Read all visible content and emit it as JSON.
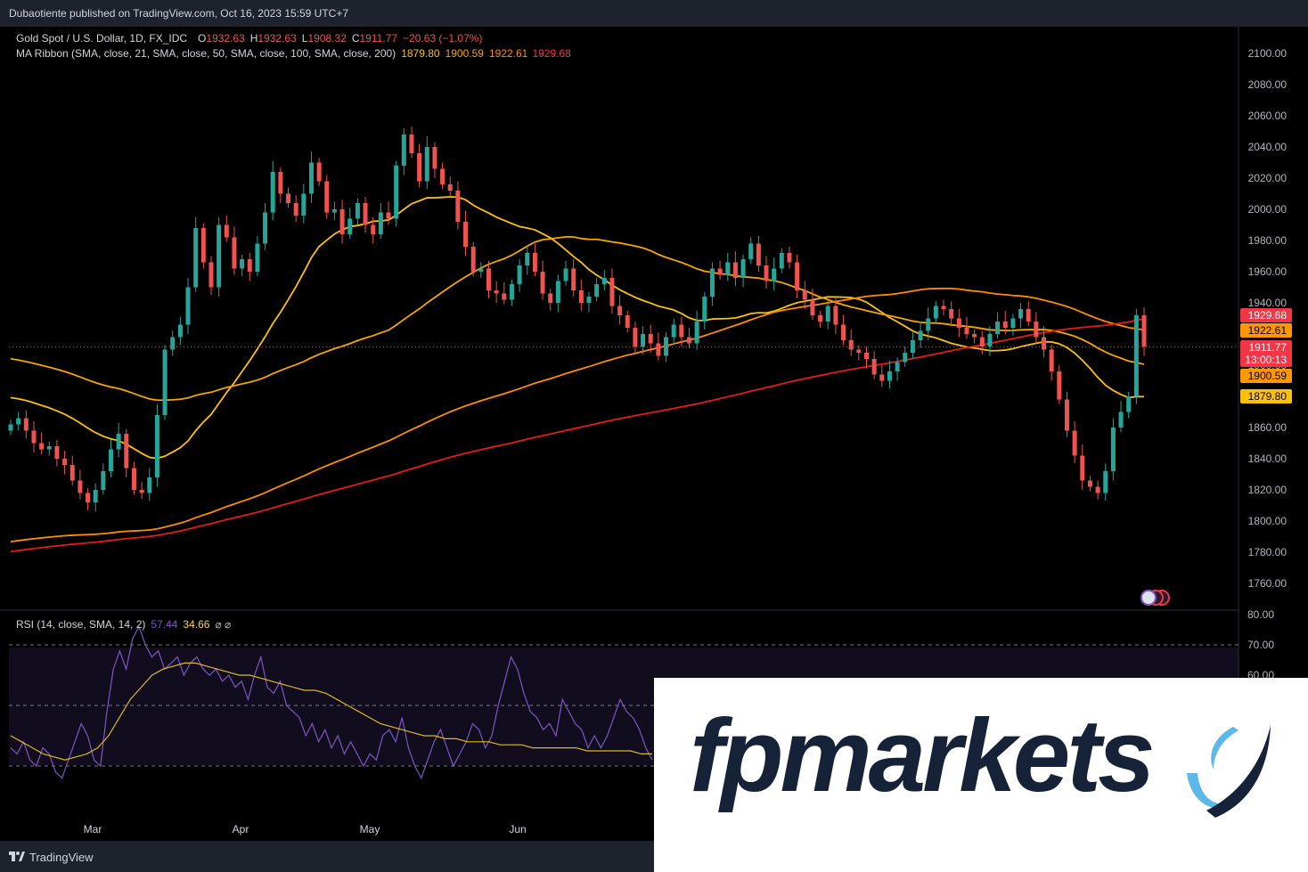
{
  "header": {
    "published": "Dubaotiente published on TradingView.com, Oct 16, 2023 15:59 UTC+7"
  },
  "legend": {
    "symbol": "Gold Spot / U.S. Dollar, 1D, FX_IDC",
    "o_label": "O",
    "o_value": "1932.63",
    "h_label": "H",
    "h_value": "1932.63",
    "l_label": "L",
    "l_value": "1908.32",
    "c_label": "C",
    "c_value": "1911.77",
    "change": "−20.63 (−1.07%)",
    "ma_label": "MA Ribbon (SMA, close, 21, SMA, close, 50, SMA, close, 100, SMA, close, 200)",
    "ma_values": [
      "1879.80",
      "1900.59",
      "1922.61",
      "1929.68"
    ],
    "rsi_label": "RSI (14, close, SMA, 14, 2)",
    "rsi_value": "57.44",
    "rsi_ma_value": "34.66",
    "rsi_extra": "⌀  ⌀"
  },
  "price_tags": [
    {
      "text": "1929.68",
      "value": 1929.68,
      "color": "#f23645"
    },
    {
      "text": "1922.61",
      "value": 1922.61,
      "color": "#ff9800"
    },
    {
      "text": "1911.77",
      "sub": "13:00:13",
      "value": 1911.77,
      "color": "#f23645"
    },
    {
      "text": "1900.59",
      "value": 1900.59,
      "color": "#ff9800"
    },
    {
      "text": "1879.80",
      "value": 1879.8,
      "color": "#ffc107"
    }
  ],
  "colors": {
    "up": "#26a69a",
    "down": "#ef5350",
    "ma21": "#ffc107",
    "ma50": "#f7a600",
    "ma100": "#ff8c00",
    "ma200": "#e31b1b",
    "rsi": "#7e57c2",
    "rsi_ma": "#ddb825"
  },
  "chart_data": [
    {
      "type": "candlestick",
      "title": "Gold Spot / U.S. Dollar, 1D, FX_IDC",
      "ylim": [
        1750,
        2110
      ],
      "y_ticks": [
        1760,
        1780,
        1800,
        1820,
        1840,
        1860,
        1880,
        1900,
        1920,
        1940,
        1960,
        1980,
        2000,
        2020,
        2040,
        2060,
        2080,
        2100
      ],
      "x_tick_labels": [
        "Mar",
        "Apr",
        "May",
        "Jun"
      ],
      "last_price": 1911.77,
      "close_series": [
        1862,
        1866,
        1858,
        1850,
        1846,
        1848,
        1840,
        1836,
        1826,
        1818,
        1812,
        1820,
        1832,
        1846,
        1856,
        1834,
        1820,
        1818,
        1828,
        1868,
        1910,
        1918,
        1926,
        1950,
        1988,
        1966,
        1950,
        1990,
        1982,
        1962,
        1968,
        1960,
        1978,
        1998,
        2024,
        2010,
        2004,
        1996,
        2010,
        2030,
        2018,
        1998,
        2000,
        1984,
        1994,
        2004,
        1990,
        1984,
        1998,
        1994,
        2028,
        2048,
        2036,
        2018,
        2040,
        2026,
        2016,
        2012,
        1992,
        1976,
        1960,
        1962,
        1948,
        1946,
        1942,
        1952,
        1964,
        1972,
        1960,
        1946,
        1940,
        1954,
        1962,
        1948,
        1940,
        1944,
        1952,
        1956,
        1938,
        1932,
        1924,
        1912,
        1920,
        1914,
        1906,
        1918,
        1926,
        1918,
        1914,
        1928,
        1944,
        1962,
        1958,
        1966,
        1956,
        1968,
        1978,
        1964,
        1954,
        1962,
        1972,
        1966,
        1948,
        1942,
        1932,
        1928,
        1938,
        1926,
        1916,
        1910,
        1908,
        1904,
        1894,
        1890,
        1896,
        1902,
        1908,
        1916,
        1922,
        1930,
        1938,
        1936,
        1930,
        1924,
        1920,
        1918,
        1912,
        1920,
        1928,
        1924,
        1930,
        1936,
        1928,
        1918,
        1910,
        1896,
        1878,
        1858,
        1842,
        1826,
        1822,
        1818,
        1832,
        1860,
        1870,
        1880,
        1932,
        1912
      ],
      "series": [
        {
          "name": "MA 21",
          "start": 1880,
          "end": 1879.8
        },
        {
          "name": "MA 50",
          "start": 1905,
          "end": 1900.59
        },
        {
          "name": "MA 100",
          "start": 1786,
          "end": 1922.61
        },
        {
          "name": "MA 200",
          "start": 1780,
          "end": 1929.68
        }
      ]
    },
    {
      "type": "line",
      "title": "RSI (14, close, SMA, 14, 2)",
      "ylim": [
        50,
        80
      ],
      "y_ticks": [
        60,
        70,
        80
      ],
      "levels": [
        70,
        50,
        30
      ],
      "series": [
        {
          "name": "RSI",
          "values": [
            36,
            34,
            38,
            32,
            30,
            36,
            34,
            28,
            26,
            32,
            38,
            44,
            40,
            32,
            30,
            48,
            62,
            68,
            62,
            72,
            76,
            70,
            66,
            68,
            62,
            64,
            66,
            60,
            64,
            66,
            62,
            60,
            62,
            58,
            60,
            56,
            58,
            52,
            60,
            66,
            56,
            54,
            58,
            50,
            48,
            46,
            40,
            44,
            38,
            42,
            36,
            40,
            34,
            38,
            34,
            30,
            34,
            32,
            40,
            42,
            38,
            46,
            36,
            30,
            26,
            32,
            38,
            42,
            36,
            30,
            34,
            38,
            44,
            42,
            36,
            40,
            50,
            58,
            66,
            62,
            54,
            48,
            46,
            42,
            44,
            40,
            52,
            48,
            44,
            42,
            36,
            40,
            36,
            40,
            46,
            52,
            48,
            46,
            42,
            36,
            32
          ]
        },
        {
          "name": "RSI-based MA",
          "values": [
            40,
            38,
            36,
            34,
            33,
            32,
            33,
            34,
            36,
            40,
            46,
            52,
            56,
            60,
            62,
            63,
            64,
            64,
            63,
            62,
            61,
            60,
            60,
            59,
            58,
            57,
            56,
            55,
            55,
            54,
            52,
            50,
            48,
            46,
            44,
            43,
            42,
            41,
            40,
            40,
            39,
            39,
            38,
            38,
            38,
            37,
            37,
            37,
            36,
            36,
            36,
            36,
            36,
            35,
            35,
            35,
            35,
            35,
            34,
            34
          ]
        }
      ]
    }
  ]
}
